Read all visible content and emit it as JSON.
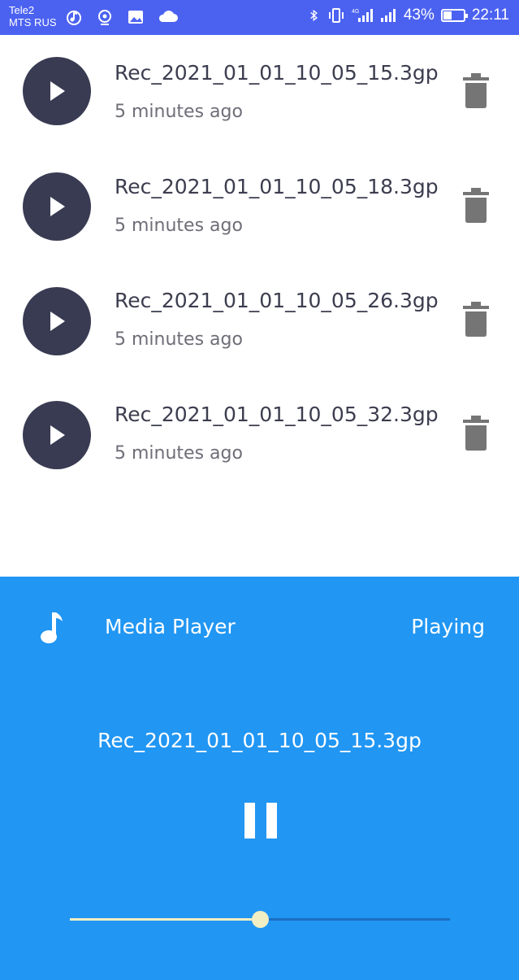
{
  "status_bar": {
    "carrier1": "Tele2",
    "carrier2": "MTS RUS",
    "battery_percent": "43%",
    "battery_level": 0.43,
    "time": "22:11"
  },
  "recordings": [
    {
      "name": "Rec_2021_01_01_10_05_15.3gp",
      "time": "5 minutes ago"
    },
    {
      "name": "Rec_2021_01_01_10_05_18.3gp",
      "time": "5 minutes ago"
    },
    {
      "name": "Rec_2021_01_01_10_05_26.3gp",
      "time": "5 minutes ago"
    },
    {
      "name": "Rec_2021_01_01_10_05_32.3gp",
      "time": "5 minutes ago"
    }
  ],
  "player": {
    "title": "Media Player",
    "status": "Playing",
    "now_playing": "Rec_2021_01_01_10_05_15.3gp",
    "progress": 0.5
  },
  "colors": {
    "status_bar": "#4b62f1",
    "player_bg": "#2196f3",
    "play_button": "#383b52",
    "seek_accent": "#f2efc4"
  }
}
